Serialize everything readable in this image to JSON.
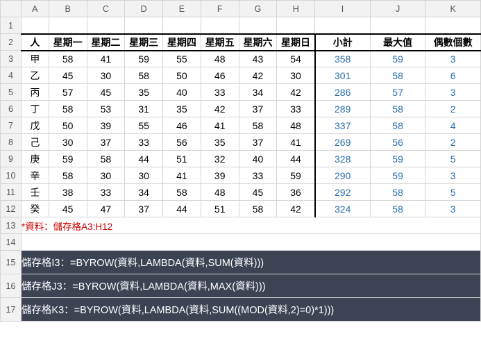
{
  "grid": {
    "col_headers": [
      "A",
      "B",
      "C",
      "D",
      "E",
      "F",
      "G",
      "H",
      "I",
      "J",
      "K"
    ],
    "row_headers": [
      "1",
      "2",
      "3",
      "4",
      "5",
      "6",
      "7",
      "8",
      "9",
      "10",
      "11",
      "12",
      "13",
      "14",
      "15",
      "16",
      "17"
    ],
    "header_row": [
      "人",
      "星期一",
      "星期二",
      "星期三",
      "星期四",
      "星期五",
      "星期六",
      "星期日",
      "小計",
      "最大值",
      "偶數個數"
    ],
    "rows": [
      {
        "label": "甲",
        "d": [
          58,
          41,
          59,
          55,
          48,
          43,
          54
        ],
        "sub": 358,
        "max": 59,
        "even": 3
      },
      {
        "label": "乙",
        "d": [
          45,
          30,
          58,
          50,
          46,
          42,
          30
        ],
        "sub": 301,
        "max": 58,
        "even": 6
      },
      {
        "label": "丙",
        "d": [
          57,
          45,
          35,
          40,
          33,
          34,
          42
        ],
        "sub": 286,
        "max": 57,
        "even": 3
      },
      {
        "label": "丁",
        "d": [
          58,
          53,
          31,
          35,
          42,
          37,
          33
        ],
        "sub": 289,
        "max": 58,
        "even": 2
      },
      {
        "label": "戊",
        "d": [
          50,
          39,
          55,
          46,
          41,
          58,
          48
        ],
        "sub": 337,
        "max": 58,
        "even": 4
      },
      {
        "label": "己",
        "d": [
          30,
          37,
          33,
          56,
          35,
          37,
          41
        ],
        "sub": 269,
        "max": 56,
        "even": 2
      },
      {
        "label": "庚",
        "d": [
          59,
          58,
          44,
          51,
          32,
          40,
          44
        ],
        "sub": 328,
        "max": 59,
        "even": 5
      },
      {
        "label": "辛",
        "d": [
          58,
          30,
          30,
          41,
          39,
          33,
          59
        ],
        "sub": 290,
        "max": 59,
        "even": 3
      },
      {
        "label": "壬",
        "d": [
          38,
          33,
          34,
          58,
          48,
          45,
          36
        ],
        "sub": 292,
        "max": 58,
        "even": 5
      },
      {
        "label": "癸",
        "d": [
          45,
          47,
          37,
          44,
          51,
          58,
          42
        ],
        "sub": 324,
        "max": 58,
        "even": 3
      }
    ],
    "note": "*資料：儲存格A3:H12",
    "formulas": [
      "儲存格I3：=BYROW(資料,LAMBDA(資料,SUM(資料)))",
      "儲存格J3：=BYROW(資料,LAMBDA(資料,MAX(資料)))",
      "儲存格K3：=BYROW(資料,LAMBDA(資料,SUM((MOD(資料,2)=0)*1)))"
    ]
  },
  "chart_data": {
    "type": "table",
    "title": "",
    "columns": [
      "人",
      "星期一",
      "星期二",
      "星期三",
      "星期四",
      "星期五",
      "星期六",
      "星期日",
      "小計",
      "最大值",
      "偶數個數"
    ],
    "rows": [
      [
        "甲",
        58,
        41,
        59,
        55,
        48,
        43,
        54,
        358,
        59,
        3
      ],
      [
        "乙",
        45,
        30,
        58,
        50,
        46,
        42,
        30,
        301,
        58,
        6
      ],
      [
        "丙",
        57,
        45,
        35,
        40,
        33,
        34,
        42,
        286,
        57,
        3
      ],
      [
        "丁",
        58,
        53,
        31,
        35,
        42,
        37,
        33,
        289,
        58,
        2
      ],
      [
        "戊",
        50,
        39,
        55,
        46,
        41,
        58,
        48,
        337,
        58,
        4
      ],
      [
        "己",
        30,
        37,
        33,
        56,
        35,
        37,
        41,
        269,
        56,
        2
      ],
      [
        "庚",
        59,
        58,
        44,
        51,
        32,
        40,
        44,
        328,
        59,
        5
      ],
      [
        "辛",
        58,
        30,
        30,
        41,
        39,
        33,
        59,
        290,
        59,
        3
      ],
      [
        "壬",
        38,
        33,
        34,
        58,
        48,
        45,
        36,
        292,
        58,
        5
      ],
      [
        "癸",
        45,
        47,
        37,
        44,
        51,
        58,
        42,
        324,
        58,
        3
      ]
    ]
  }
}
